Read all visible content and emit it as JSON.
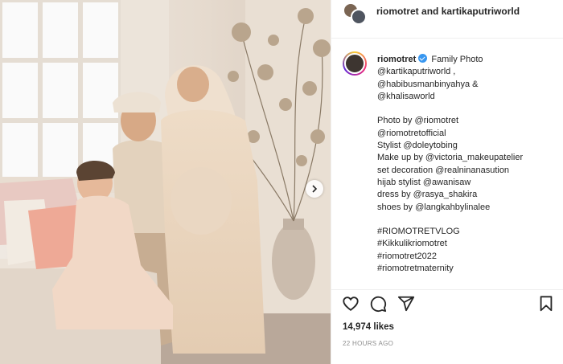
{
  "header": {
    "user1": "riomotret",
    "and": "and",
    "user2": "kartikaputriworld"
  },
  "caption": {
    "username": "riomotret",
    "lines": [
      "Family Photo",
      "@kartikaputriworld ,",
      "@habibusmanbinyahya &",
      "@khalisaworld",
      "",
      "Photo by @riomotret",
      "@riomotretofficial",
      "Stylist @doleytobing",
      "Make up by @victoria_makeupatelier",
      "set decoration @realninanasution",
      "hijab stylist @awanisaw",
      "dress by @rasya_shakira",
      "shoes by @langkahbylinalee",
      "",
      "#RIOMOTRETVLOG",
      "#Kikkulikriomotret",
      "#riomotret2022",
      "#riomotretmaternity"
    ]
  },
  "actions": {
    "like_icon": "heart-icon",
    "comment_icon": "comment-icon",
    "share_icon": "share-icon",
    "save_icon": "bookmark-icon"
  },
  "likes": "14,974 likes",
  "time": "22 HOURS AGO",
  "colors": {
    "verified": "#3897f0",
    "text": "#262626",
    "muted": "#8e8e8e"
  }
}
